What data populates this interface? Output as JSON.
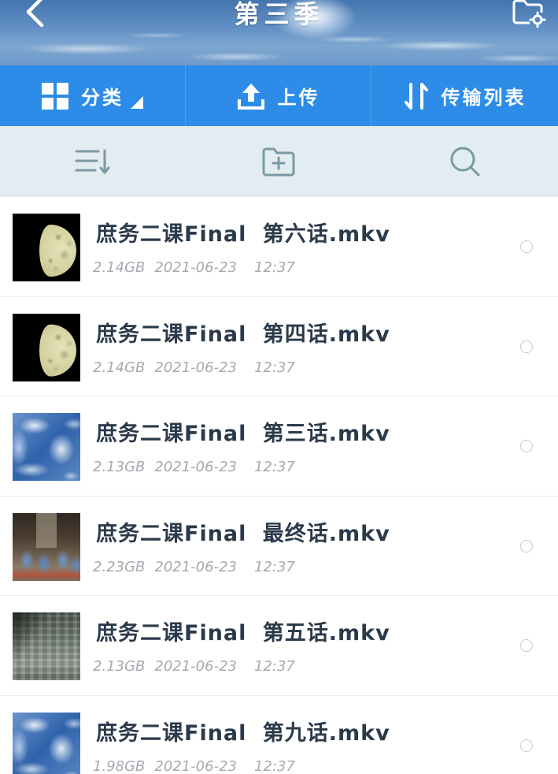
{
  "theme": {
    "toolbar_color": "#2c8ce7",
    "action_bar_color": "#e3ecf0",
    "action_icon_color": "#7b98a6",
    "title_color": "#2b3a4b",
    "meta_color": "#a4aab0"
  },
  "header": {
    "title": "第三季",
    "back_icon": "back-chevron-icon",
    "settings_icon": "folder-settings-icon"
  },
  "toolbar": {
    "category": {
      "label": "分类",
      "icon": "grid-icon",
      "dropdown_icon": "corner-triangle-icon"
    },
    "upload": {
      "label": "上传",
      "icon": "upload-icon"
    },
    "transfers": {
      "label": "传输列表",
      "icon": "transfer-arrows-icon"
    }
  },
  "actions": {
    "sort_icon": "sort-list-icon",
    "new_folder_icon": "add-folder-icon",
    "search_icon": "search-icon"
  },
  "files": [
    {
      "thumbnail_icon": "moon",
      "name": "庶务二课Final 第六话.mkv",
      "size": "2.14GB",
      "date": "2021-06-23",
      "time": "12:37",
      "selected": false
    },
    {
      "thumbnail_icon": "moon",
      "name": "庶务二课Final 第四话.mkv",
      "size": "2.14GB",
      "date": "2021-06-23",
      "time": "12:37",
      "selected": false
    },
    {
      "thumbnail_icon": "ocean-clouds",
      "name": "庶务二课Final 第三话.mkv",
      "size": "2.13GB",
      "date": "2021-06-23",
      "time": "12:37",
      "selected": false
    },
    {
      "thumbnail_icon": "classroom",
      "name": "庶务二课Final 最终话.mkv",
      "size": "2.23GB",
      "date": "2021-06-23",
      "time": "12:37",
      "selected": false
    },
    {
      "thumbnail_icon": "aerial-city",
      "name": "庶务二课Final 第五话.mkv",
      "size": "2.13GB",
      "date": "2021-06-23",
      "time": "12:37",
      "selected": false
    },
    {
      "thumbnail_icon": "ocean-clouds",
      "name": "庶务二课Final 第九话.mkv",
      "size": "1.98GB",
      "date": "2021-06-23",
      "time": "12:37",
      "selected": false
    }
  ]
}
